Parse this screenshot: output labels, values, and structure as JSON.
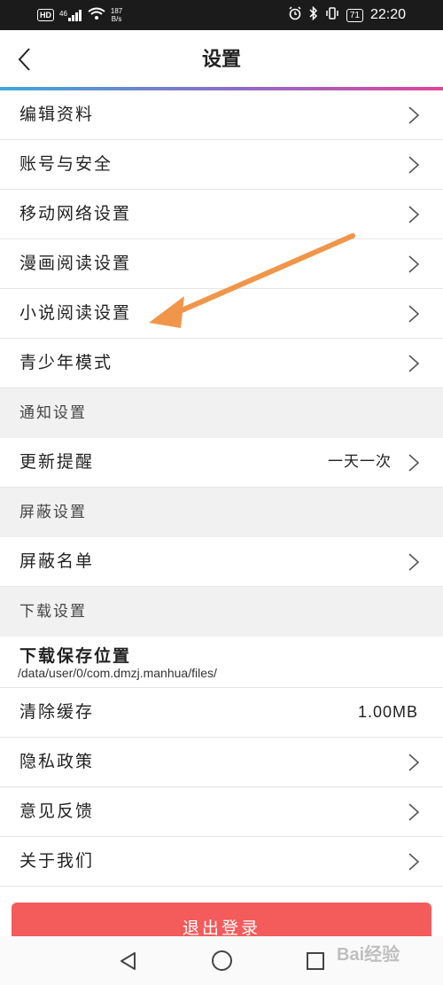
{
  "status_bar": {
    "hd": "HD",
    "network": "46",
    "speed_value": "187",
    "speed_unit": "B/s",
    "battery": "71",
    "time": "22:20"
  },
  "header": {
    "title": "设置",
    "back_icon": "chevron-left-icon"
  },
  "items": {
    "edit_profile": "编辑资料",
    "account_security": "账号与安全",
    "mobile_network": "移动网络设置",
    "comic_reading": "漫画阅读设置",
    "novel_reading": "小说阅读设置",
    "youth_mode": "青少年模式",
    "notify_section": "通知设置",
    "update_reminder": "更新提醒",
    "update_reminder_value": "一天一次",
    "block_section": "屏蔽设置",
    "block_list": "屏蔽名单",
    "download_section": "下载设置",
    "download_location": "下载保存位置",
    "download_path": "/data/user/0/com.dmzj.manhua/files/",
    "clear_cache": "清除缓存",
    "cache_size": "1.00MB",
    "privacy_policy": "隐私政策",
    "feedback": "意见反馈",
    "about_us": "关于我们"
  },
  "logout_label": "退出登录",
  "watermark": "Bai经验",
  "colors": {
    "accent_start": "#3fa8d8",
    "accent_end": "#e0459b",
    "logout": "#f45b5b",
    "annotation_arrow": "#f0964a"
  }
}
